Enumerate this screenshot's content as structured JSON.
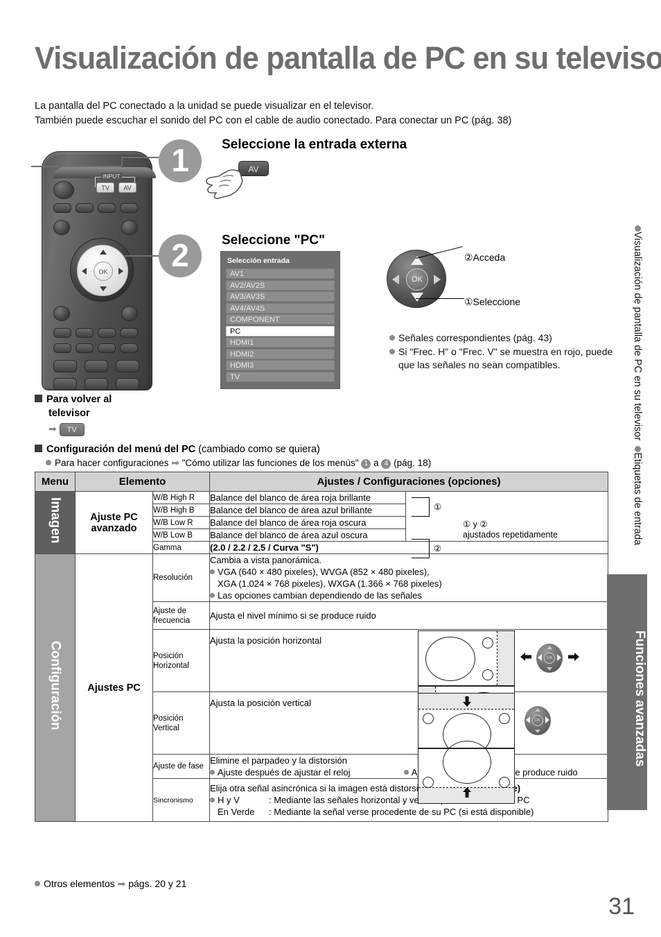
{
  "page": {
    "title": "Visualización de pantalla de PC en su televisor",
    "intro_line1": "La pantalla del PC conectado a la unidad se puede visualizar en el televisor.",
    "intro_line2": "También puede escuchar el sonido del PC con el cable de audio conectado. Para conectar un PC (pág. 38)",
    "page_number": "31",
    "footer_note": "Otros elementos",
    "footer_arrow": "➡",
    "footer_ref": "págs. 20 y 21"
  },
  "sidebar": {
    "item1": "Visualización de pantalla de PC en su televisor",
    "item2": "Etiquetas de entrada",
    "tab_label": "Funciones avanzadas"
  },
  "remote": {
    "input_label": "INPUT",
    "tv_key": "TV",
    "av_key": "AV",
    "ok_label": "OK"
  },
  "steps": [
    {
      "number": "1",
      "heading": "Seleccione la entrada externa",
      "key_label": "AV"
    },
    {
      "number": "2",
      "heading": "Seleccione \"PC\""
    }
  ],
  "input_menu": {
    "title": "Selección entrada",
    "items": [
      {
        "label": "AV1",
        "selected": false
      },
      {
        "label": "AV2/AV2S",
        "selected": false
      },
      {
        "label": "AV3/AV3S",
        "selected": false
      },
      {
        "label": "AV4/AV4S",
        "selected": false
      },
      {
        "label": "COMPONENT",
        "selected": false
      },
      {
        "label": "PC",
        "selected": true
      },
      {
        "label": "HDMI1",
        "selected": false
      },
      {
        "label": "HDMI2",
        "selected": false
      },
      {
        "label": "HDMI3",
        "selected": false
      },
      {
        "label": "TV",
        "selected": false
      }
    ]
  },
  "cursor_callouts": {
    "ok_label": "OK",
    "access": "②Acceda",
    "select": "①Seleccione"
  },
  "notes": [
    "Señales correspondientes (pág. 43)",
    "Si \"Frec. H\" o \"Frec. V\" se muestra en rojo, puede que las señales no sean compatibles."
  ],
  "back_to_tv": {
    "heading_line1": "Para volver al",
    "heading_line2": "televisor",
    "key": "TV"
  },
  "pc_menu_config": {
    "heading_bold": "Configuración del menú del PC",
    "heading_rest": "(cambiado como se quiera)",
    "bullet_pre": "Para hacer configuraciones",
    "bullet_quote": "\"Cómo utilizar las funciones de los menús\"",
    "badge1": "1",
    "connector": "a",
    "badge2": "4",
    "page_ref": "(pág. 18)"
  },
  "table": {
    "headers": {
      "menu": "Menu",
      "element": "Elemento",
      "settings": "Ajustes / Configuraciones (opciones)"
    },
    "sections": [
      {
        "menu": "Imagen",
        "element": "Ajuste PC avanzado",
        "rows": [
          {
            "sub": "W/B High R",
            "desc": "Balance del blanco de área roja brillante"
          },
          {
            "sub": "W/B High B",
            "desc": "Balance del blanco de área azul brillante"
          },
          {
            "sub": "W/B Low R",
            "desc": "Balance del blanco de área roja oscura"
          },
          {
            "sub": "W/B Low B",
            "desc": "Balance del blanco de área azul oscura"
          },
          {
            "sub": "Gamma",
            "desc": "(2.0 / 2.2 / 2.5 / Curva \"S\")"
          }
        ],
        "side_note": {
          "mark1": "①",
          "mark2": "②",
          "text_line1": "① y ②",
          "text_line2": "ajustados repetidamente"
        }
      },
      {
        "menu": "Configuración",
        "element": "Ajustes PC",
        "rows": [
          {
            "sub": "Resolución",
            "desc_line1": "Cambia a vista panorámica.",
            "bullet1_line1": "VGA (640 × 480 pixeles), WVGA (852 × 480 pixeles),",
            "bullet1_line2": "XGA (1.024 × 768 pixeles), WXGA (1.366 × 768 pixeles)",
            "bullet2": "Las opciones cambian dependiendo de las señales"
          },
          {
            "sub": "Ajuste de frecuencia",
            "desc": "Ajusta el nivel mínimo si se produce ruido"
          },
          {
            "sub": "Posición Horizontal",
            "desc": "Ajusta la posición horizontal"
          },
          {
            "sub": "Posición Vertical",
            "desc": "Ajusta la posición vertical"
          },
          {
            "sub": "Ajuste de fase",
            "desc": "Elimine el parpadeo y la distorsión",
            "bullet1": "Ajuste después de ajustar el reloj",
            "bullet2": "Ajuste el nivel mínimo si se produce ruido"
          },
          {
            "sub": "Sincronismo",
            "desc_line1": "Elija otra señal asincrónica si la imagen está distorsionada",
            "desc_bold": "(H y V / En Verde)",
            "opt1_name": "H y V",
            "opt1_text": ": Mediante las señales horizontal y vertical procedentes de su PC",
            "opt2_name": "En Verde",
            "opt2_text": ": Mediante la señal verse procedente de su PC (si está disponible)"
          }
        ]
      }
    ]
  }
}
